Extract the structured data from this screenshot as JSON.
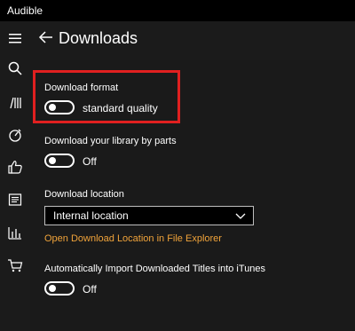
{
  "app": {
    "title": "Audible"
  },
  "header": {
    "title": "Downloads"
  },
  "nav": {
    "icons": [
      "hamburger-icon",
      "search-icon",
      "library-icon",
      "stopwatch-icon",
      "thumbs-up-icon",
      "notes-icon",
      "stats-icon",
      "cart-icon"
    ]
  },
  "settings": {
    "download_format": {
      "label": "Download format",
      "value": "standard quality"
    },
    "library_by_parts": {
      "label": "Download your library by parts",
      "value": "Off"
    },
    "download_location": {
      "label": "Download location",
      "selected": "Internal location",
      "link": "Open Download Location in File Explorer"
    },
    "import_itunes": {
      "label": "Automatically Import Downloaded Titles into iTunes",
      "value": "Off"
    }
  },
  "colors": {
    "accent_link": "#f0a33a",
    "highlight": "#e02020"
  }
}
